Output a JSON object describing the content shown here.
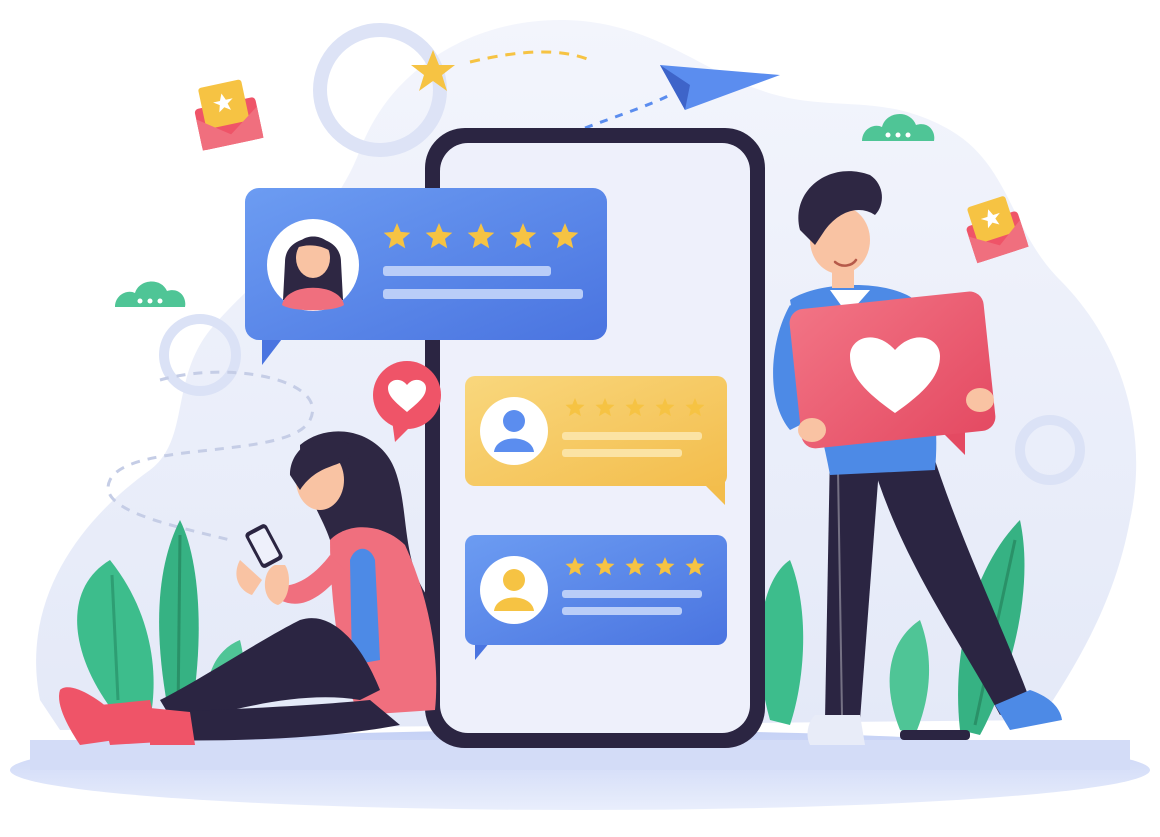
{
  "illustration": {
    "theme": "customer-reviews-feedback",
    "colors": {
      "background_blob": "#e8ecf8",
      "floor_shadow": "#c9d4f5",
      "phone_frame": "#2b2542",
      "phone_screen": "#eef0fb",
      "review_blue": "#5b8def",
      "review_blue_dark": "#4a74e0",
      "review_yellow": "#f6c85f",
      "review_line": "#b9cdf8",
      "star": "#f6c343",
      "heart_red": "#ef5468",
      "woman_hair": "#2e2743",
      "woman_top": "#f06f7e",
      "man_shirt": "#4d8ae6",
      "pants": "#2b2542",
      "leaf_green": "#3dbd8c",
      "cloud_green": "#4fc596",
      "skin": "#f9c3a3"
    },
    "reviews": [
      {
        "card": "top-blue",
        "avatar": "woman-avatar-icon",
        "stars": 5
      },
      {
        "card": "middle-yellow",
        "avatar": "user-avatar-icon",
        "stars": 5
      },
      {
        "card": "bottom-blue",
        "avatar": "user-avatar-icon",
        "stars": 5
      }
    ],
    "icons": [
      "star-icon",
      "paper-plane-icon",
      "envelope-star-icon",
      "chat-cloud-icon",
      "heart-bubble-icon",
      "heart-sign-icon",
      "smartphone-icon"
    ]
  }
}
